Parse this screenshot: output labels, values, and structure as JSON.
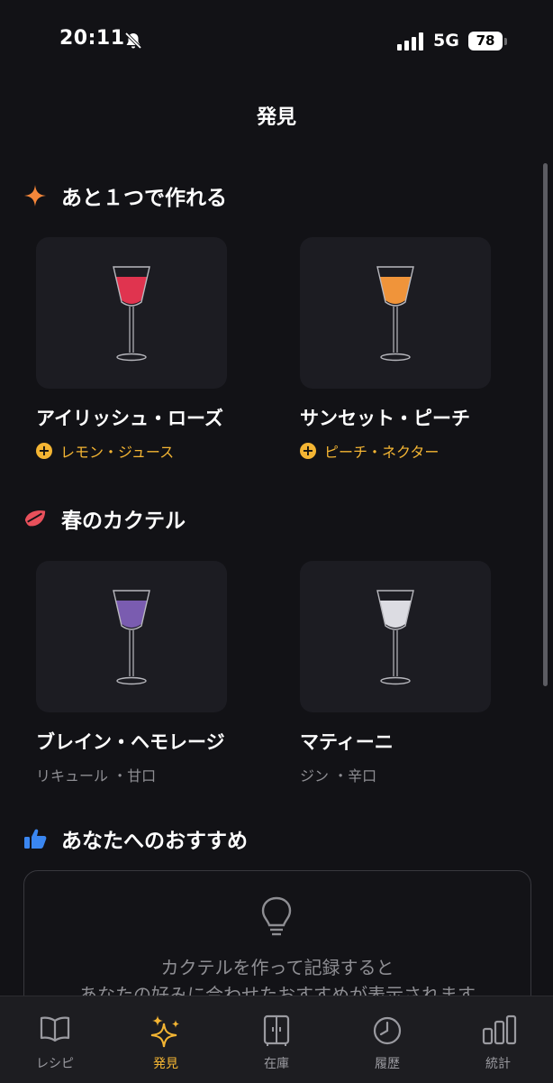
{
  "status_bar": {
    "time": "20:11",
    "network": "5G",
    "battery": "78"
  },
  "header": {
    "title": "発見"
  },
  "sections": {
    "almost": {
      "title": "あと１つで作れる",
      "icon": "sparkle-icon",
      "items": [
        {
          "name": "アイリッシュ・ローズ",
          "missing": "レモン・ジュース",
          "liquid_color": "#e0344f"
        },
        {
          "name": "サンセット・ピーチ",
          "missing": "ピーチ・ネクター",
          "liquid_color": "#f0943a"
        }
      ]
    },
    "spring": {
      "title": "春のカクテル",
      "icon": "leaf-icon",
      "items": [
        {
          "name": "ブレイン・ヘモレージ",
          "meta": "リキュール ・甘口",
          "liquid_color": "#7a5cb0"
        },
        {
          "name": "マティーニ",
          "meta": "ジン ・辛口",
          "liquid_color": "#dcdce2"
        }
      ]
    },
    "recommend": {
      "title": "あなたへのおすすめ",
      "icon": "thumbs-up-icon",
      "empty_line1": "カクテルを作って記録すると",
      "empty_line2": "あなたの好みに合わせたおすすめが表示されます"
    }
  },
  "tabs": [
    {
      "label": "レシピ",
      "icon": "book-icon",
      "active": false
    },
    {
      "label": "発見",
      "icon": "sparkles-icon",
      "active": true
    },
    {
      "label": "在庫",
      "icon": "cabinet-icon",
      "active": false
    },
    {
      "label": "履歴",
      "icon": "clock-icon",
      "active": false
    },
    {
      "label": "統計",
      "icon": "bar-chart-icon",
      "active": false
    }
  ],
  "colors": {
    "accent": "#f4b533",
    "background": "#121216",
    "card": "#1c1c22",
    "sparkle": "#f4863a",
    "leaf": "#e8505b",
    "thumb": "#3a86f0"
  }
}
